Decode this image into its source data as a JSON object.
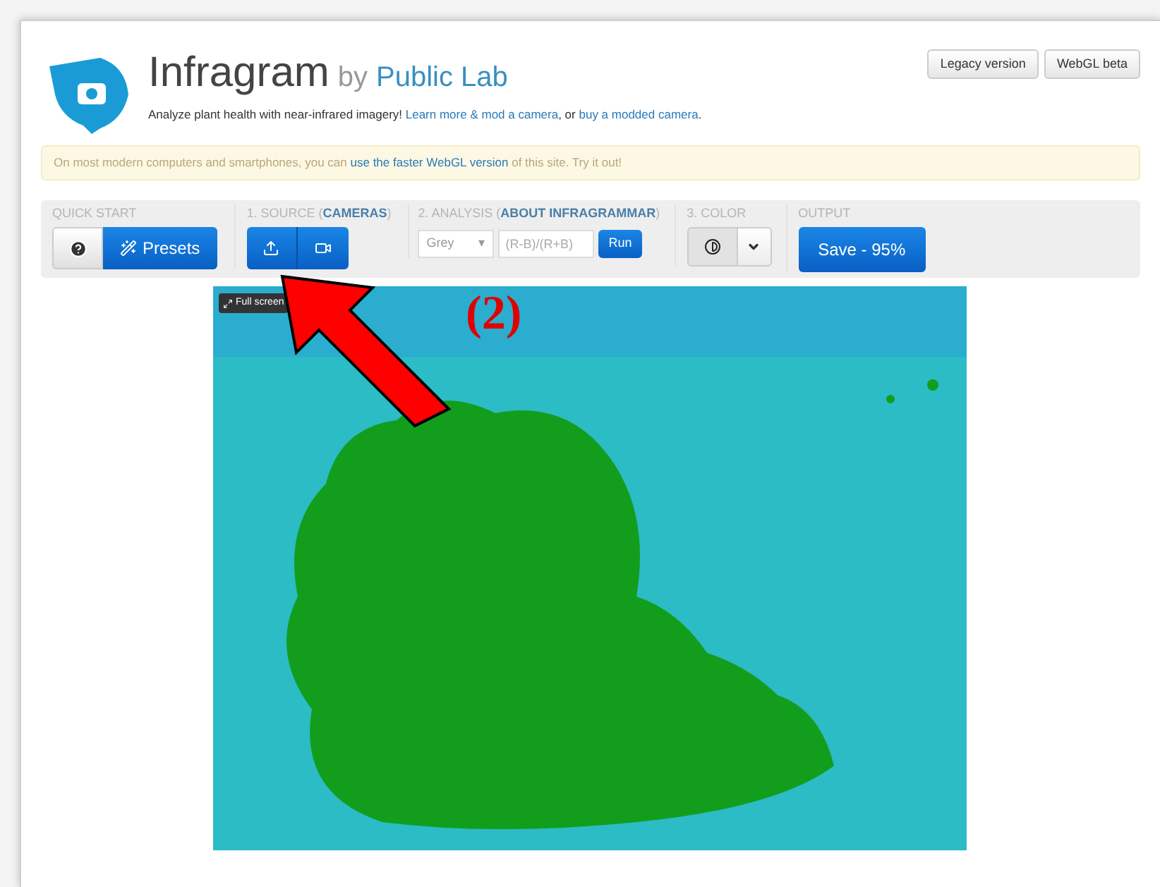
{
  "header": {
    "title": "Infragram",
    "by": "by",
    "brand": "Public Lab",
    "tagline": [
      {
        "text": "Analyze plant health with near-infrared imagery! ",
        "link": false
      },
      {
        "text": "Learn more & mod a camera",
        "link": true
      },
      {
        "text": ", or ",
        "link": false
      },
      {
        "text": "buy a modded camera",
        "link": true
      },
      {
        "text": ".",
        "link": false
      }
    ],
    "buttons": [
      "Legacy version",
      "WebGL beta"
    ]
  },
  "alert": [
    {
      "text": "On most modern computers and smartphones, you can ",
      "link": false
    },
    {
      "text": "use the faster WebGL version",
      "link": true
    },
    {
      "text": " of this site. Try it out!",
      "link": false
    }
  ],
  "toolbar": {
    "quick_start": {
      "label": "QUICK START",
      "presets": "Presets"
    },
    "source": {
      "label": "1. SOURCE (",
      "link": "CAMERAS",
      "close": ")"
    },
    "analysis": {
      "label": "2. ANALYSIS (",
      "link": "ABOUT INFRAGRAMMAR",
      "close": ")",
      "select": "Grey",
      "select_caret": "▾",
      "placeholder": "(R-B)/(R+B)",
      "run": "Run"
    },
    "color": {
      "label": "3. COLOR"
    },
    "output": {
      "label": "OUTPUT",
      "save": "Save - 95%"
    }
  },
  "image": {
    "fullscreen": "Full screen"
  },
  "annotation": {
    "label": "(2)"
  }
}
